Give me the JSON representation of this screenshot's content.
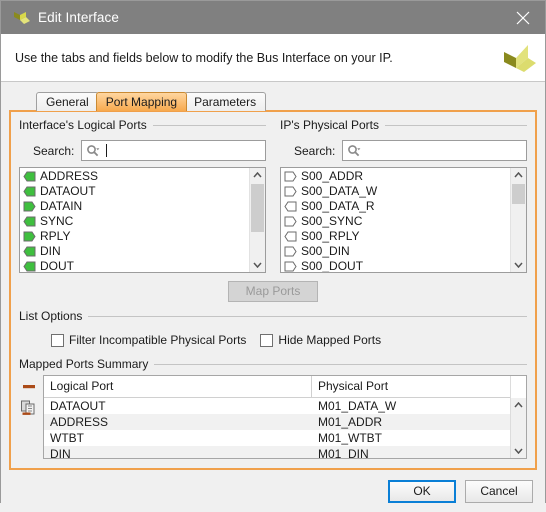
{
  "window": {
    "title": "Edit Interface",
    "logo_icon": "xilinx-logo-icon",
    "close_icon": "close-icon"
  },
  "banner": {
    "text": "Use the tabs and fields below to modify the Bus Interface on your IP.",
    "logo_icon": "xilinx-logo-icon"
  },
  "tabs": [
    {
      "label": "General",
      "active": false
    },
    {
      "label": "Port Mapping",
      "active": true
    },
    {
      "label": "Parameters",
      "active": false
    }
  ],
  "logical_ports": {
    "group_title": "Interface's Logical Ports",
    "search": {
      "label": "Search:",
      "value": "",
      "placeholder": "",
      "icon": "search-icon",
      "focused": true
    },
    "items": [
      {
        "name": "ADDRESS",
        "direction": "in"
      },
      {
        "name": "DATAOUT",
        "direction": "in"
      },
      {
        "name": "DATAIN",
        "direction": "out"
      },
      {
        "name": "SYNC",
        "direction": "in"
      },
      {
        "name": "RPLY",
        "direction": "out"
      },
      {
        "name": "DIN",
        "direction": "in"
      },
      {
        "name": "DOUT",
        "direction": "in"
      }
    ]
  },
  "physical_ports": {
    "group_title": "IP's Physical Ports",
    "search": {
      "label": "Search:",
      "value": "",
      "placeholder": "",
      "icon": "search-icon",
      "focused": false
    },
    "items": [
      {
        "name": "S00_ADDR",
        "direction": "out"
      },
      {
        "name": "S00_DATA_W",
        "direction": "out"
      },
      {
        "name": "S00_DATA_R",
        "direction": "in"
      },
      {
        "name": "S00_SYNC",
        "direction": "out"
      },
      {
        "name": "S00_RPLY",
        "direction": "in"
      },
      {
        "name": "S00_DIN",
        "direction": "out"
      },
      {
        "name": "S00_DOUT",
        "direction": "out"
      }
    ]
  },
  "map_button": {
    "label": "Map Ports",
    "mnemonic": "t",
    "enabled": false
  },
  "list_options": {
    "group_title": "List Options",
    "checkboxes": [
      {
        "label": "Filter Incompatible Physical Ports",
        "mnemonic": "F",
        "checked": false
      },
      {
        "label": "Hide Mapped Ports",
        "mnemonic": "H",
        "checked": false
      }
    ]
  },
  "mapped_summary": {
    "group_title": "Mapped Ports Summary",
    "tools": [
      {
        "icon": "remove-mapping-icon"
      },
      {
        "icon": "copy-mapping-icon"
      }
    ],
    "columns": [
      "Logical Port",
      "Physical Port"
    ],
    "rows": [
      {
        "logical": "DATAOUT",
        "physical": "M01_DATA_W",
        "selected": false
      },
      {
        "logical": "ADDRESS",
        "physical": "M01_ADDR",
        "selected": true
      },
      {
        "logical": "WTBT",
        "physical": "M01_WTBT",
        "selected": false
      },
      {
        "logical": "DIN",
        "physical": "M01_DIN",
        "selected": true
      }
    ]
  },
  "footer": {
    "ok_label": "OK",
    "cancel_label": "Cancel"
  },
  "colors": {
    "accent_orange": "#f0a04b",
    "titlebar": "#808080",
    "focus_blue": "#0a7fd6",
    "port_green": "#3fbf3f"
  }
}
